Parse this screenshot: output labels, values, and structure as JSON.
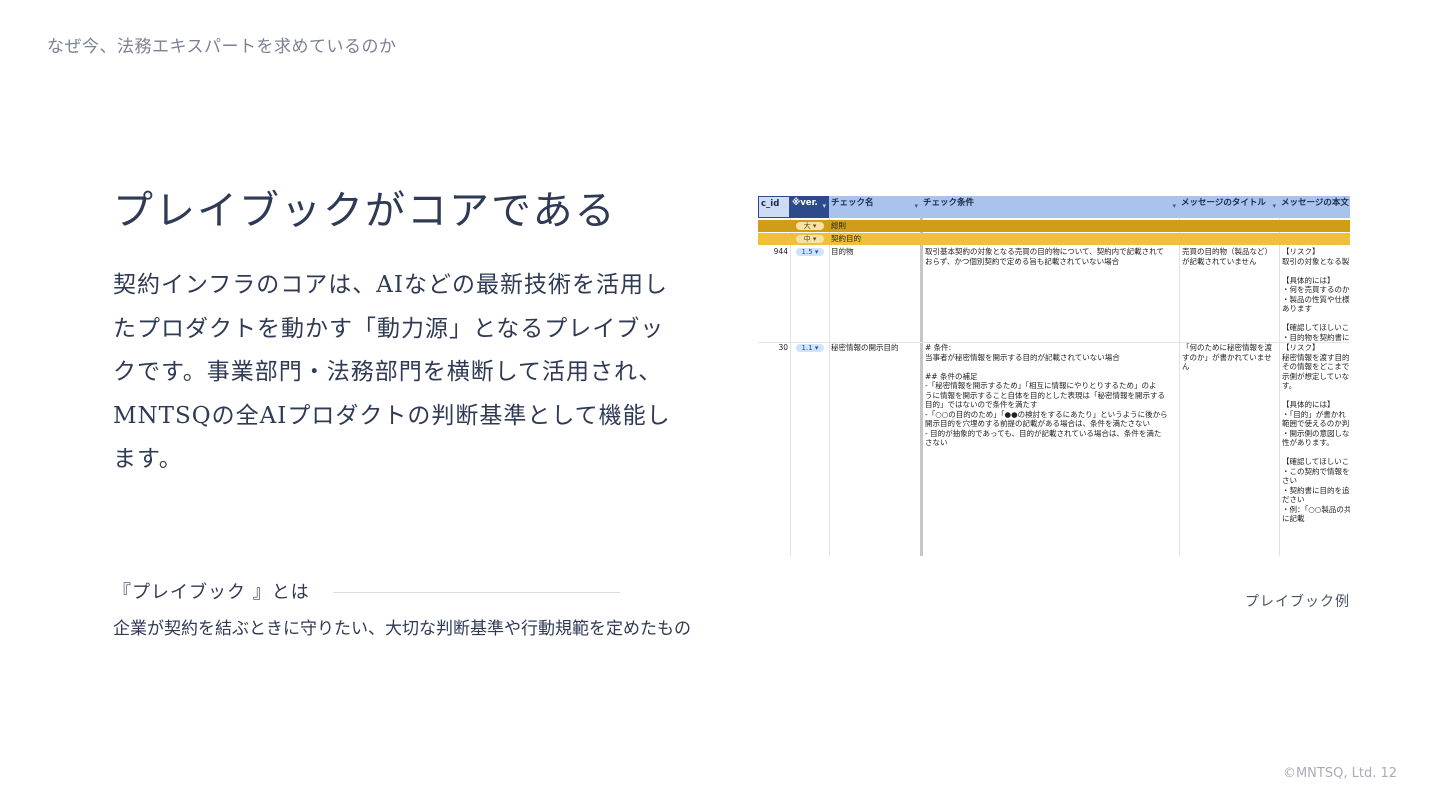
{
  "breadcrumb": "なぜ今、法務エキスパートを求めているのか",
  "title": "プレイブックがコアである",
  "body": {
    "lines": [
      "契約インフラのコアは、AIなどの最新技術を活用し",
      "たプロダクトを動かす「動力源」となるプレイブッ",
      "クです。事業部門・法務部門を横断して活用され、",
      "MNTSQの全AIプロダクトの判断基準として機能し",
      "ます。"
    ]
  },
  "definition": {
    "title": "『プレイブック 』とは",
    "text": "企業が契約を結ぶときに守りたい、大切な判断基準や行動規範を定めたもの"
  },
  "image_caption": "プレイブック例",
  "footer": "©MNTSQ, Ltd. 12",
  "sheet": {
    "headers": [
      "c_id",
      "※ver.",
      "チェック名",
      "チェック条件",
      "メッセージのタイトル",
      "メッセージの本文"
    ],
    "bands": [
      {
        "level": "大",
        "label": "総則"
      },
      {
        "level": "中",
        "label": "契約目的"
      }
    ],
    "rows": [
      {
        "id": "944",
        "ver": "1.5",
        "name": "目的物",
        "condition": "取引基本契約の対象となる売買の目的物について、契約内で記載されて\nおらず、かつ個別契約で定める旨も記載されていない場合",
        "msg_title": "売買の目的物（製品など）\nが記載されていません",
        "msg_body": "【リスク】\n取引の対象となる製\n\n【具体的には】\n・何を売買するのか\n・製品の性質や仕様\nあります\n\n【確認してほしいこ\n・目的物を契約書に"
      },
      {
        "id": "30",
        "ver": "1.1",
        "name": "秘密情報の開示目的",
        "condition": "# 条件:\n当事者が秘密情報を開示する目的が記載されていない場合\n\n## 条件の補足\n-「秘密情報を開示するため」「相互に情報にやりとりするため」のよ\nうに情報を開示すること自体を目的とした表現は「秘密情報を開示する\n目的」ではないので条件を満たす\n-「○○の目的のため」「●●の検討をするにあたり」というように後から\n開示目的を穴埋めする前提の記載がある場合は、条件を満たさない\n- 目的が抽象的であっても、目的が記載されている場合は、条件を満た\nさない",
        "msg_title": "「何のために秘密情報を渡\nすのか」が書かれていませ\nん",
        "msg_body": "【リスク】\n秘密情報を渡す目的\nその情報をどこまで\n示側が想定していな\nす。\n\n【具体的には】\n・「目的」が書かれ\n範囲で使えるのか判\n・開示側の意図しな\n性があります。\n\n【確認してほしいこ\n・この契約で情報を\nさい\n・契約書に目的を追\nださい\n・例：「○○製品の共\nに記載"
      }
    ]
  }
}
